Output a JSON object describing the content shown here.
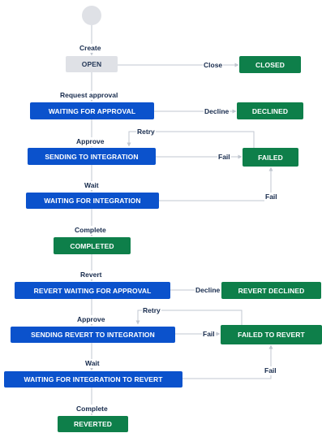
{
  "colors": {
    "status_blue": "#0b52cc",
    "status_green": "#0e7f4a",
    "status_grey": "#dfe1e6",
    "connector": "#c1c7d0",
    "label_text": "#172b4d"
  },
  "statuses": {
    "open": "OPEN",
    "closed": "CLOSED",
    "waiting_for_approval": "WAITING FOR APPROVAL",
    "declined": "DECLINED",
    "sending_to_integration": "SENDING TO INTEGRATION",
    "failed": "FAILED",
    "waiting_for_integration": "WAITING FOR INTEGRATION",
    "completed": "COMPLETED",
    "revert_waiting_for_approval": "REVERT WAITING FOR APPROVAL",
    "revert_declined": "REVERT DECLINED",
    "sending_revert_to_integration": "SENDING REVERT TO INTEGRATION",
    "failed_to_revert": "FAILED TO REVERT",
    "waiting_for_integration_to_revert": "WAITING FOR INTEGRATION TO REVERT",
    "reverted": "REVERTED"
  },
  "transitions": {
    "create": "Create",
    "close": "Close",
    "request_approval": "Request approval",
    "decline": "Decline",
    "approve": "Approve",
    "retry": "Retry",
    "fail_sending": "Fail",
    "wait": "Wait",
    "fail_waiting": "Fail",
    "complete": "Complete",
    "revert": "Revert",
    "decline_revert": "Decline",
    "approve_revert": "Approve",
    "retry_revert": "Retry",
    "fail_sending_revert": "Fail",
    "wait_revert": "Wait",
    "fail_waiting_revert": "Fail",
    "complete_revert": "Complete"
  }
}
